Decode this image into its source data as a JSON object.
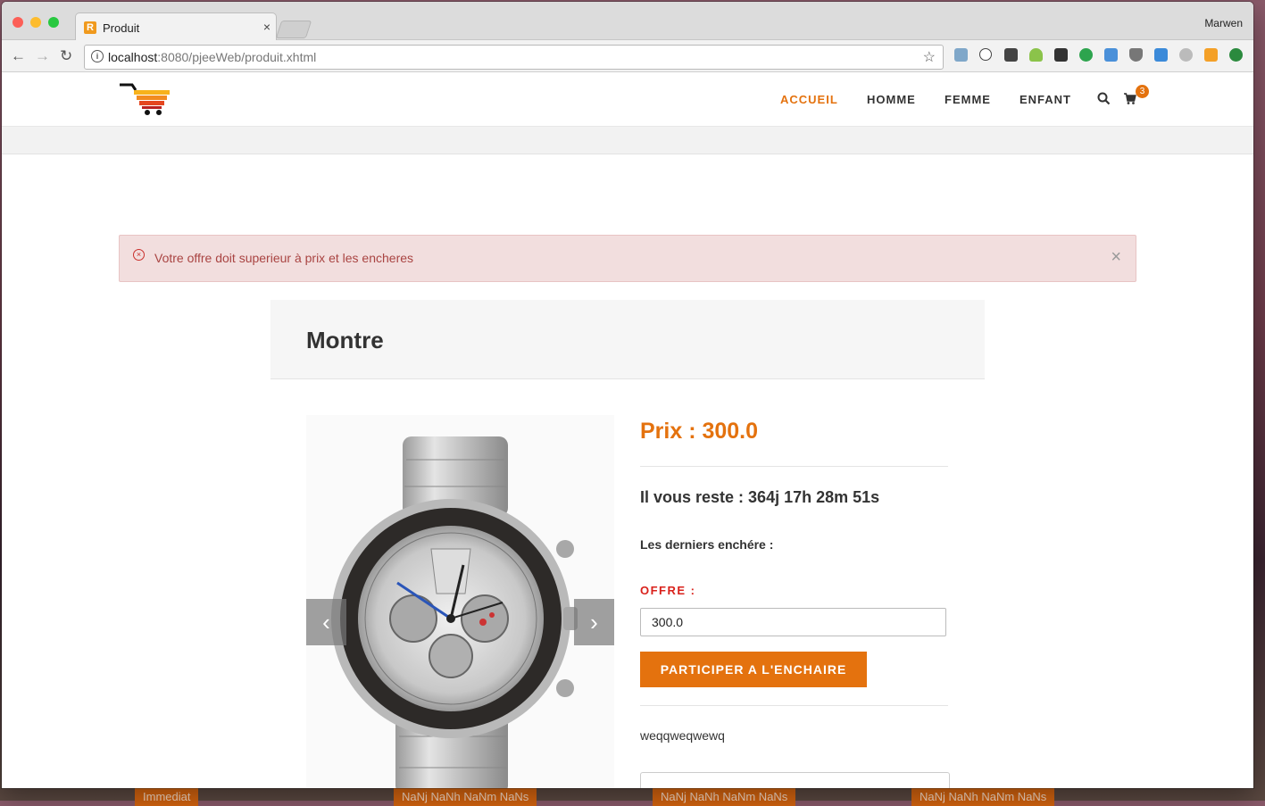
{
  "browser": {
    "tab_title": "Produit",
    "tab_favicon": "R",
    "tab_close": "×",
    "profile_name": "Marwen",
    "url_host": "localhost",
    "url_rest": ":8080/pjeeWeb/produit.xhtml"
  },
  "site": {
    "menu": [
      "ACCUEIL",
      "HOMME",
      "FEMME",
      "ENFANT"
    ],
    "active_menu": "ACCUEIL",
    "cart_count": "3"
  },
  "alert": {
    "message": "Votre offre doit superieur à prix et les encheres",
    "close": "×"
  },
  "product": {
    "title": "Montre",
    "price": "Prix : 300.0",
    "countdown": "Il vous reste : 364j 17h 28m 51s",
    "last_bids_label": "Les derniers enchére :",
    "offer_label": "OFFRE :",
    "offer_value": "300.0",
    "bid_button": "PARTICIPER A L'ENCHAIRE",
    "comment": "weqqweqwewq",
    "prev_arrow": "‹",
    "next_arrow": "›"
  },
  "background_tags": [
    "Immediat",
    "NaNj NaNh NaNm NaNs",
    "NaNj NaNh NaNm NaNs",
    "NaNj NaNh NaNm NaNs"
  ],
  "colors": {
    "accent": "#e4720e",
    "alert_bg": "#f2dede",
    "alert_text": "#a94442",
    "offer_label": "#d9211b"
  },
  "icons": [
    "back-icon",
    "forward-icon",
    "reload-icon",
    "info-icon",
    "star-icon",
    "search-icon",
    "cart-icon",
    "alert-error-icon",
    "close-icon"
  ]
}
